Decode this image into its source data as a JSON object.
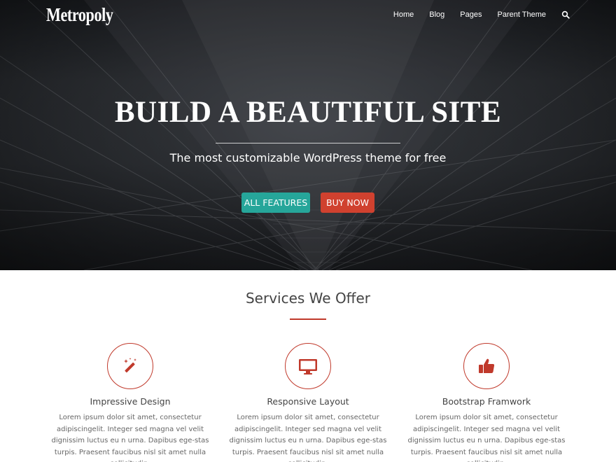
{
  "header": {
    "logo": "Metropoly",
    "nav": [
      "Home",
      "Blog",
      "Pages",
      "Parent Theme"
    ],
    "search_icon": "search-icon"
  },
  "hero": {
    "title": "BUILD A BEAUTIFUL SITE",
    "subtitle": "The most customizable WordPress theme for free",
    "buttons": {
      "features": "ALL FEATURES",
      "buy": "BUY NOW"
    }
  },
  "services": {
    "title": "Services We Offer",
    "items": [
      {
        "icon": "magic-wand-icon",
        "title": "Impressive Design",
        "text": "Lorem ipsum dolor sit amet, consectetur adipiscingelit. Integer sed magna vel velit dignissim luctus eu n urna. Dapibus ege-stas turpis. Praesent faucibus nisl sit amet nulla sollicitudin."
      },
      {
        "icon": "desktop-icon",
        "title": "Responsive Layout",
        "text": "Lorem ipsum dolor sit amet, consectetur adipiscingelit. Integer sed magna vel velit dignissim luctus eu n urna. Dapibus ege-stas turpis. Praesent faucibus nisl sit amet nulla sollicitudin."
      },
      {
        "icon": "thumbs-up-icon",
        "title": "Bootstrap Framwork",
        "text": "Lorem ipsum dolor sit amet, consectetur adipiscingelit. Integer sed magna vel velit dignissim luctus eu n urna. Dapibus ege-stas turpis. Praesent faucibus nisl sit amet nulla sollicitudin."
      }
    ]
  },
  "colors": {
    "accent_red": "#c0392b",
    "button_teal": "#26a69a",
    "button_red": "#d0412f"
  }
}
